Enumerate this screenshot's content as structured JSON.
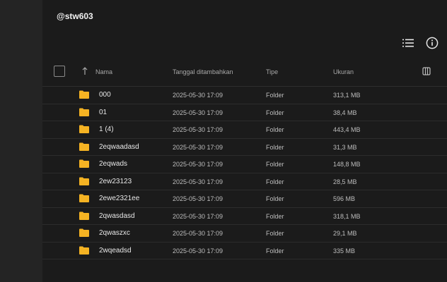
{
  "title": "@stw603",
  "icons": {
    "list": "list-view-icon",
    "info": "info-icon",
    "sort": "sort-ascending-icon",
    "columns": "columns-icon",
    "folder": "folder-icon"
  },
  "colors": {
    "folder": "#f5b323",
    "background": "#1b1b1b",
    "sidebar": "#242424"
  },
  "columns": {
    "name": "Nama",
    "date": "Tanggal ditambahkan",
    "type": "Tipe",
    "size": "Ukuran"
  },
  "rows": [
    {
      "name": "000",
      "date": "2025-05-30 17:09",
      "type": "Folder",
      "size": "313,1 MB"
    },
    {
      "name": "01",
      "date": "2025-05-30 17:09",
      "type": "Folder",
      "size": "38,4 MB"
    },
    {
      "name": "1 (4)",
      "date": "2025-05-30 17:09",
      "type": "Folder",
      "size": "443,4 MB"
    },
    {
      "name": "2eqwaadasd",
      "date": "2025-05-30 17:09",
      "type": "Folder",
      "size": "31,3 MB"
    },
    {
      "name": "2eqwads",
      "date": "2025-05-30 17:09",
      "type": "Folder",
      "size": "148,8 MB"
    },
    {
      "name": "2ew23123",
      "date": "2025-05-30 17:09",
      "type": "Folder",
      "size": "28,5 MB"
    },
    {
      "name": "2ewe2321ee",
      "date": "2025-05-30 17:09",
      "type": "Folder",
      "size": "596 MB"
    },
    {
      "name": "2qwasdasd",
      "date": "2025-05-30 17:09",
      "type": "Folder",
      "size": "318,1 MB"
    },
    {
      "name": "2qwaszxc",
      "date": "2025-05-30 17:09",
      "type": "Folder",
      "size": "29,1 MB"
    },
    {
      "name": "2wqeadsd",
      "date": "2025-05-30 17:09",
      "type": "Folder",
      "size": "335 MB"
    }
  ]
}
